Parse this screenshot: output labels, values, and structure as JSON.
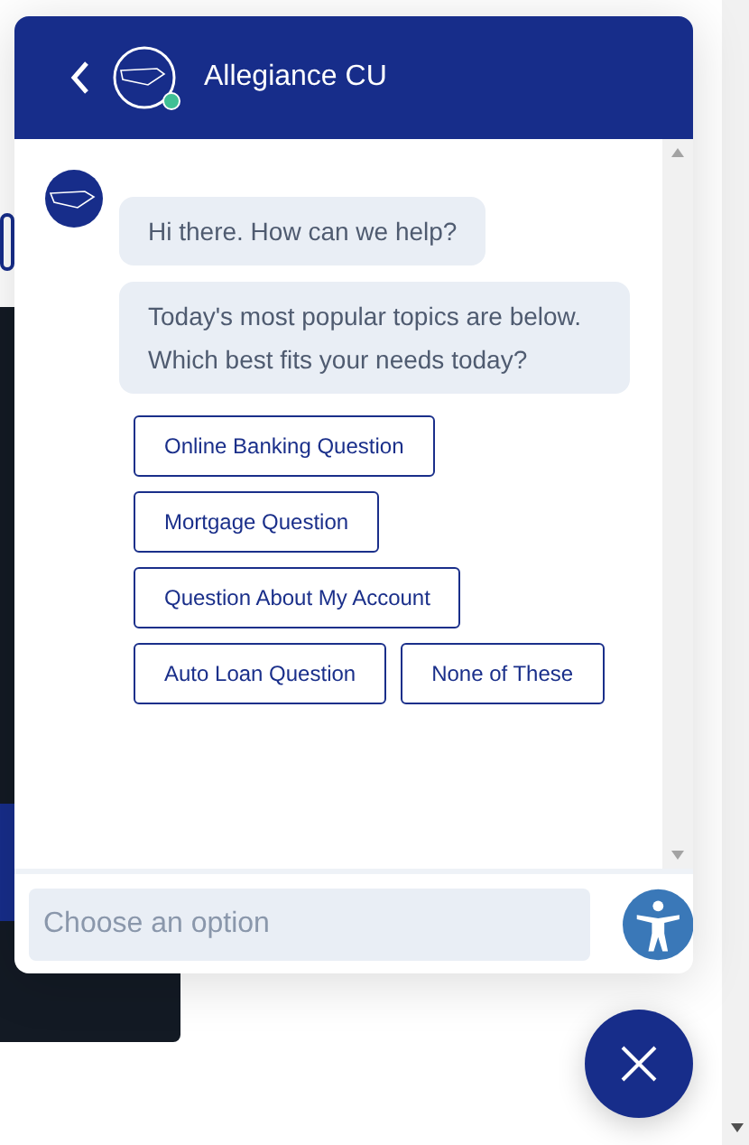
{
  "chat": {
    "title": "Allegiance CU",
    "online": true,
    "messages": [
      "Hi there. How can we help?",
      "Today's most popular topics are below. Which best fits your needs today?"
    ],
    "options": [
      "Online Banking Question",
      "Mortgage Question",
      "Question About My Account",
      "Auto Loan Question",
      "None of These"
    ],
    "input": {
      "placeholder": "Choose an option"
    }
  }
}
